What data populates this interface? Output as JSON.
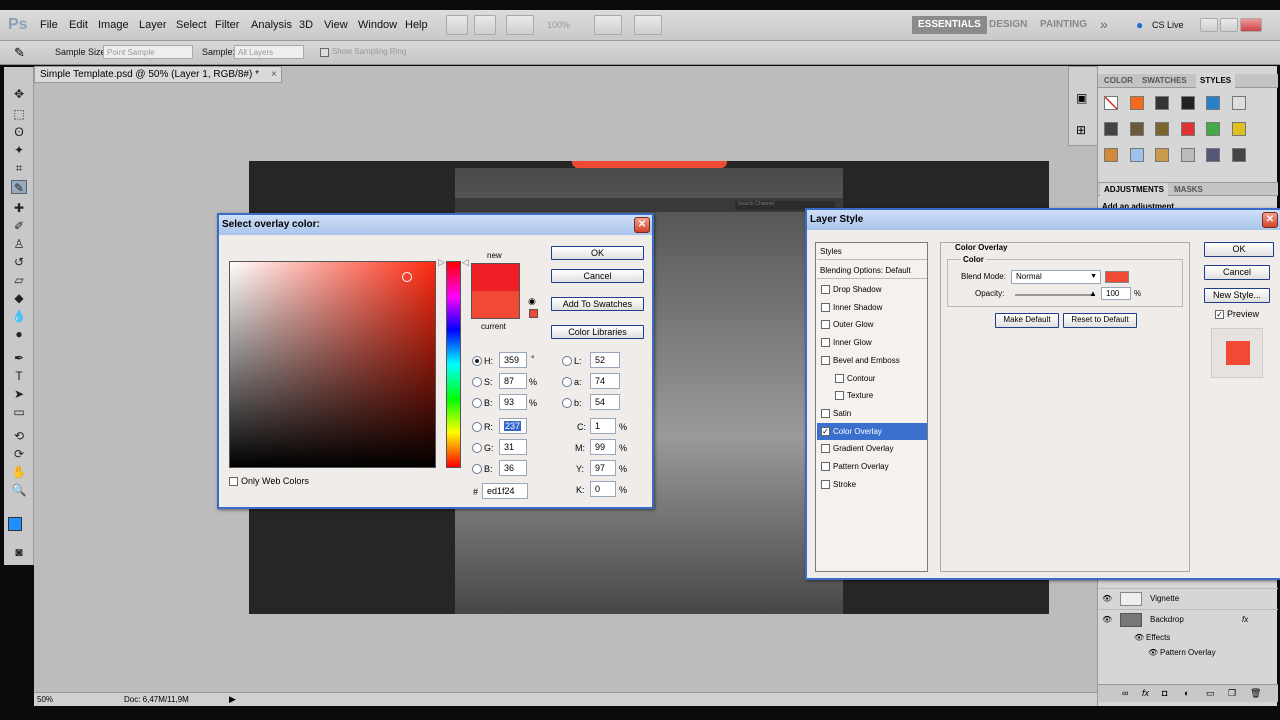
{
  "app": {
    "logo": "Ps",
    "menu": [
      "File",
      "Edit",
      "Image",
      "Layer",
      "Select",
      "Filter",
      "Analysis",
      "3D",
      "View",
      "Window",
      "Help"
    ],
    "zoom": "100%",
    "workspaces": [
      "ESSENTIALS",
      "DESIGN",
      "PAINTING"
    ],
    "more": "»",
    "cslive": "CS Live"
  },
  "options": {
    "sample_size_label": "Sample Size:",
    "sample_size_value": "Point Sample",
    "sample_label": "Sample:",
    "sample_value": "All Layers",
    "show_ring": "Show Sampling Ring"
  },
  "document": {
    "tab_title": "Simple Template.psd @ 50% (Layer 1, RGB/8#) *",
    "close": "×",
    "search_placeholder": "Search Channel"
  },
  "status": {
    "zoom": "50%",
    "doc": "Doc: 6,47M/11,9M"
  },
  "panels": {
    "tabs_top": [
      "COLOR",
      "SWATCHES",
      "STYLES"
    ],
    "tabs_adj": [
      "ADJUSTMENTS",
      "MASKS"
    ],
    "adj_text": "Add an adjustment",
    "layers": [
      {
        "name": "Vignette"
      },
      {
        "name": "Backdrop",
        "fx": "fx"
      },
      {
        "name": "Effects"
      },
      {
        "name": "Pattern Overlay"
      }
    ]
  },
  "picker": {
    "title": "Select overlay color:",
    "ok": "OK",
    "cancel": "Cancel",
    "add_swatches": "Add To Swatches",
    "color_libraries": "Color Libraries",
    "new_label": "new",
    "current_label": "current",
    "only_web": "Only Web Colors",
    "new_color": "#ed1f24",
    "current_color": "#f04a35",
    "H": "359",
    "S": "87",
    "B": "93",
    "R": "237",
    "G": "31",
    "Bl": "36",
    "L": "52",
    "a": "74",
    "b": "54",
    "C": "1",
    "M": "99",
    "Y": "97",
    "K": "0",
    "hex": "ed1f24",
    "labels": {
      "H": "H:",
      "S": "S:",
      "B": "B:",
      "R": "R:",
      "G": "G:",
      "Bl": "B:",
      "L": "L:",
      "a": "a:",
      "b": "b:",
      "C": "C:",
      "M": "M:",
      "Y": "Y:",
      "K": "K:",
      "hash": "#",
      "deg": "°",
      "pct": "%"
    }
  },
  "layerstyle": {
    "title": "Layer Style",
    "styles_header": "Styles",
    "blending": "Blending Options: Default",
    "items": [
      {
        "label": "Drop Shadow",
        "checked": false
      },
      {
        "label": "Inner Shadow",
        "checked": false
      },
      {
        "label": "Outer Glow",
        "checked": false
      },
      {
        "label": "Inner Glow",
        "checked": false
      },
      {
        "label": "Bevel and Emboss",
        "checked": false
      },
      {
        "label": "Contour",
        "checked": false
      },
      {
        "label": "Texture",
        "checked": false
      },
      {
        "label": "Satin",
        "checked": false
      },
      {
        "label": "Color Overlay",
        "checked": true
      },
      {
        "label": "Gradient Overlay",
        "checked": false
      },
      {
        "label": "Pattern Overlay",
        "checked": false
      },
      {
        "label": "Stroke",
        "checked": false
      }
    ],
    "section": "Color Overlay",
    "subsection": "Color",
    "blend_mode_label": "Blend Mode:",
    "blend_mode": "Normal",
    "opacity_label": "Opacity:",
    "opacity": "100",
    "pct": "%",
    "make_default": "Make Default",
    "reset_default": "Reset to Default",
    "ok": "OK",
    "cancel": "Cancel",
    "new_style": "New Style...",
    "preview": "Preview",
    "overlay_color": "#f04a35"
  }
}
